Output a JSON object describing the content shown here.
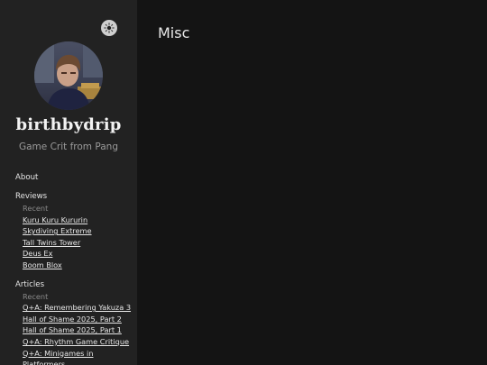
{
  "sidebar": {
    "site_title": "birthbydrip",
    "site_subtitle": "Game Crit from Pang",
    "about_label": "About",
    "reviews": {
      "heading": "Reviews",
      "recent_label": "Recent",
      "items": [
        {
          "label": "Kuru Kuru Kururin"
        },
        {
          "label": "Skydiving Extreme"
        },
        {
          "label": "Tall Twins Tower"
        },
        {
          "label": "Deus Ex"
        },
        {
          "label": "Boom Blox"
        }
      ]
    },
    "articles": {
      "heading": "Articles",
      "recent_label": "Recent",
      "items": [
        {
          "label": "Q+A: Remembering Yakuza 3"
        },
        {
          "label": "Hall of Shame 2025, Part 2"
        },
        {
          "label": "Hall of Shame 2025, Part 1"
        },
        {
          "label": "Q+A: Rhythm Game Critique"
        },
        {
          "label": "Q+A: Minigames in Platformers"
        }
      ]
    },
    "theme_toggle_icon": "sun-icon"
  },
  "main": {
    "page_title": "Misc"
  },
  "colors": {
    "sidebar_bg": "#222222",
    "main_bg": "#141414",
    "text": "#e6e6e6",
    "muted": "#8a8a8a"
  }
}
